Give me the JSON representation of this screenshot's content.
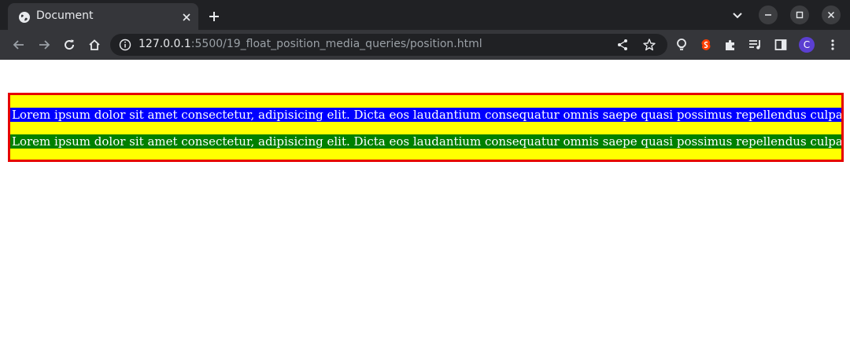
{
  "tab": {
    "title": "Document"
  },
  "url": {
    "host": "127.0.0.1",
    "path": ":5500/19_float_position_media_queries/position.html"
  },
  "profile": {
    "initial": "C"
  },
  "colors": {
    "container_border": "#e60000",
    "container_background": "#ffff00",
    "box_one_background": "#0000ff",
    "box_two_background": "#008000",
    "avatar": "#5b3fd1",
    "svelte_extension": "#ff3e00"
  },
  "icons": {
    "tab": [
      "globe-icon",
      "close-icon",
      "plus-icon",
      "chevron-down-icon",
      "minimize-icon",
      "maximize-icon",
      "close-window-icon"
    ],
    "toolbar": [
      "back-icon",
      "forward-icon",
      "reload-icon",
      "home-icon",
      "info-icon",
      "share-icon",
      "star-icon",
      "lightbulb-icon",
      "svelte-icon",
      "puzzle-icon",
      "media-control-icon",
      "side-panel-icon",
      "kebab-menu-icon"
    ]
  },
  "page": {
    "box_one_text": "Lorem ipsum dolor sit amet consectetur, adipisicing elit. Dicta eos laudantium consequatur omnis saepe quasi possimus repellendus culpa corrupti amet.",
    "box_two_text": "Lorem ipsum dolor sit amet consectetur, adipisicing elit. Dicta eos laudantium consequatur omnis saepe quasi possimus repellendus culpa corrupti amet."
  }
}
